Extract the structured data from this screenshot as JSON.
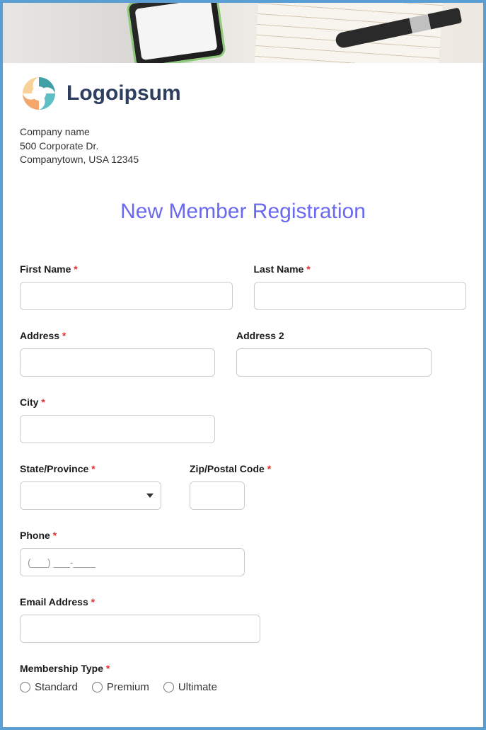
{
  "logo": {
    "text": "Logoipsum"
  },
  "company": {
    "name": "Company name",
    "street": "500 Corporate Dr.",
    "citystate": "Companytown, USA 12345"
  },
  "form": {
    "title": "New Member Registration",
    "fields": {
      "first_name": {
        "label": "First Name",
        "required": true
      },
      "last_name": {
        "label": "Last Name",
        "required": true
      },
      "address": {
        "label": "Address",
        "required": true
      },
      "address2": {
        "label": "Address 2",
        "required": false
      },
      "city": {
        "label": "City",
        "required": true
      },
      "state": {
        "label": "State/Province",
        "required": true
      },
      "zip": {
        "label": "Zip/Postal Code",
        "required": true
      },
      "phone": {
        "label": "Phone",
        "required": true,
        "placeholder": "(___) ___-____"
      },
      "email": {
        "label": "Email Address",
        "required": true
      },
      "membership": {
        "label": "Membership Type",
        "required": true,
        "options": [
          "Standard",
          "Premium",
          "Ultimate"
        ]
      }
    }
  }
}
